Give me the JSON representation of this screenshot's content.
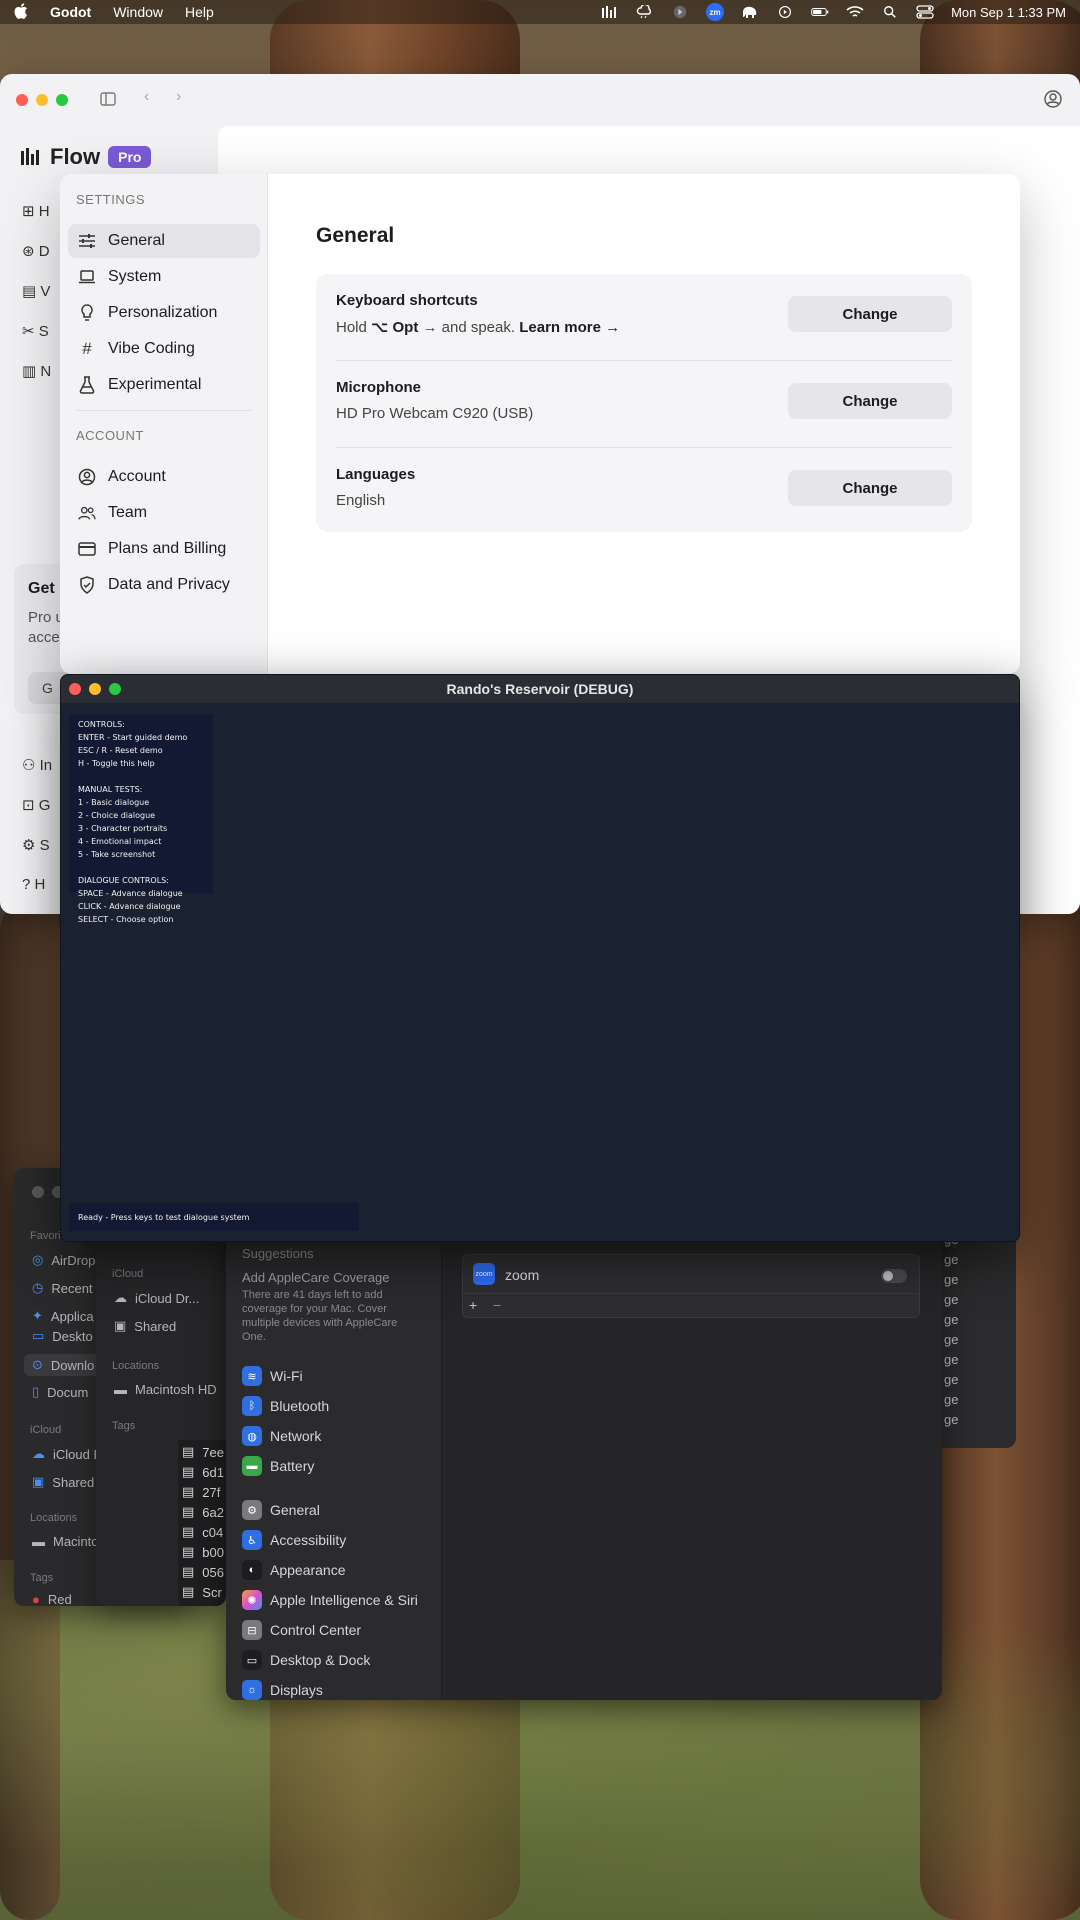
{
  "menubar": {
    "app_name": "Godot",
    "menus": [
      "Window",
      "Help"
    ],
    "zoom_badge": "zm",
    "clock": "Mon Sep 1  1:33 PM"
  },
  "flow": {
    "brand": "Flow",
    "badge": "Pro",
    "sidebar_initials": [
      "H",
      "D",
      "V",
      "S",
      "N"
    ],
    "bottom_items": [
      "In",
      "G",
      "S",
      "H"
    ],
    "promo": {
      "title": "Get I",
      "text_line1": "Pro u",
      "text_line2": "acce",
      "button": "G"
    }
  },
  "settings": {
    "section_settings": "SETTINGS",
    "section_account": "ACCOUNT",
    "nav_settings": [
      {
        "label": "General",
        "icon": "sliders-icon"
      },
      {
        "label": "System",
        "icon": "laptop-icon"
      },
      {
        "label": "Personalization",
        "icon": "lightbulb-icon"
      },
      {
        "label": "Vibe Coding",
        "icon": "hash-icon"
      },
      {
        "label": "Experimental",
        "icon": "flask-icon"
      }
    ],
    "nav_account": [
      {
        "label": "Account",
        "icon": "user-circle-icon"
      },
      {
        "label": "Team",
        "icon": "team-icon"
      },
      {
        "label": "Plans and Billing",
        "icon": "credit-card-icon"
      },
      {
        "label": "Data and Privacy",
        "icon": "shield-check-icon"
      }
    ],
    "title": "General",
    "rows": [
      {
        "label": "Keyboard shortcuts",
        "value_prefix": "Hold ",
        "value_key": "⌥ Opt",
        "value_mid": " → and speak. ",
        "value_link": "Learn more →",
        "button": "Change"
      },
      {
        "label": "Microphone",
        "value": "HD Pro Webcam C920 (USB)",
        "button": "Change"
      },
      {
        "label": "Languages",
        "value": "English",
        "button": "Change"
      }
    ]
  },
  "godot": {
    "title": "Rando's Reservoir (DEBUG)",
    "help_lines": [
      "CONTROLS:",
      "ENTER - Start guided demo",
      "ESC / R - Reset demo",
      "H - Toggle this help",
      "",
      "MANUAL TESTS:",
      "1 - Basic dialogue",
      "2 - Choice dialogue",
      "3 - Character portraits",
      "4 - Emotional impact",
      "5 - Take screenshot",
      "",
      "DIALOGUE CONTROLS:",
      "SPACE - Advance dialogue",
      "CLICK - Advance dialogue",
      "SELECT - Choose option"
    ],
    "status": "Ready - Press keys to test dialogue system"
  },
  "finder": {
    "favorites_label": "Favori",
    "items": [
      "AirDrop",
      "Recent",
      "Applica",
      "Deskto",
      "Downlo",
      "Docum"
    ],
    "icloud_label": "iCloud",
    "icloud_items": [
      "iCloud Dr...",
      "Shared"
    ],
    "locations_label": "Locations",
    "locations_items": [
      "Macintosh HD"
    ],
    "tags_label": "Tags",
    "tags_items": [
      "Red"
    ],
    "files": [
      "7ee",
      "6d1",
      "27f",
      "6a2",
      "c04",
      "b00",
      "056",
      "Scr"
    ]
  },
  "system_settings": {
    "suggestions": "Suggestions",
    "applecare_title": "Add AppleCare Coverage",
    "applecare_text": "There are 41 days left to add coverage for your Mac. Cover multiple devices with AppleCare One.",
    "group1": [
      "Wi-Fi",
      "Bluetooth",
      "Network",
      "Battery"
    ],
    "group2": [
      "General",
      "Accessibility",
      "Appearance",
      "Apple Intelligence & Siri",
      "Control Center",
      "Desktop & Dock",
      "Displays"
    ],
    "app_row": {
      "name": "zoom",
      "icon_text": "zoom"
    },
    "plus": "+",
    "minus": "−"
  },
  "right_list": {
    "items": [
      "ge",
      "ge",
      "ge",
      "ge",
      "ge",
      "ge",
      "ge",
      "ge",
      "ge",
      "ge"
    ]
  }
}
